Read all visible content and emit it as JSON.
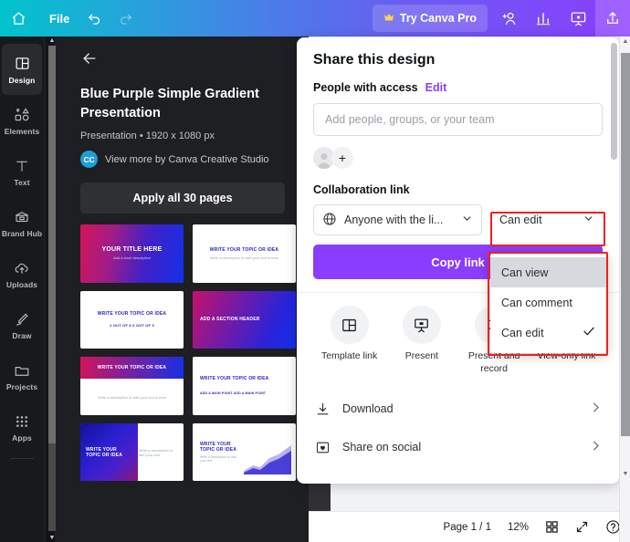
{
  "topbar": {
    "home_icon": "home-icon",
    "file_label": "File",
    "undo_icon": "undo-icon",
    "redo_icon": "redo-icon",
    "pro_label": "Try Canva Pro",
    "crown_icon": "crown-icon",
    "add_person_icon": "add-person-icon",
    "analytics_icon": "bar-chart-icon",
    "present_icon": "present-icon",
    "share_icon": "share-upload-icon",
    "gradient_start": "#00c4cc",
    "gradient_end": "#8b3dff"
  },
  "sidebar": {
    "items": [
      {
        "label": "Design",
        "icon": "layout-icon",
        "active": true
      },
      {
        "label": "Elements",
        "icon": "shapes-icon",
        "active": false
      },
      {
        "label": "Text",
        "icon": "text-t-icon",
        "active": false
      },
      {
        "label": "Brand Hub",
        "icon": "brand-hub-icon",
        "active": false
      },
      {
        "label": "Uploads",
        "icon": "cloud-up-icon",
        "active": false
      },
      {
        "label": "Draw",
        "icon": "pencil-icon",
        "active": false
      },
      {
        "label": "Projects",
        "icon": "folder-icon",
        "active": false
      },
      {
        "label": "Apps",
        "icon": "grid-dots-icon",
        "active": false
      }
    ]
  },
  "template_panel": {
    "back_icon": "back-arrow-icon",
    "title": "Blue Purple Simple Gradient Presentation",
    "meta": "Presentation • 1920 x 1080 px",
    "author_badge": "CC",
    "author_text": "View more by Canva Creative Studio",
    "apply_label": "Apply all 30 pages",
    "thumbnails": [
      {
        "style": "grad1",
        "layout": "center",
        "title": "YOUR TITLE HERE",
        "sub": "Add a short description"
      },
      {
        "style": "white",
        "layout": "center",
        "title": "WRITE YOUR TOPIC OR IDEA",
        "sub": "Write a description or add your text in here"
      },
      {
        "style": "white",
        "layout": "center",
        "title": "WRITE YOUR TOPIC OR IDEA",
        "sub": "2 OUT OF 8         9 OUT OF 9"
      },
      {
        "style": "grad2",
        "layout": "center",
        "title": "ADD A SECTION HEADER",
        "sub": ""
      },
      {
        "style": "grad1",
        "layout": "center",
        "title": "WRITE YOUR TOPIC OR IDEA",
        "sub": "Write a description or add your text in here"
      },
      {
        "style": "white",
        "layout": "left",
        "title": "WRITE YOUR TOPIC OR IDEA",
        "sub": "ADD A MAIN POINT        ADD A MAIN POINT"
      },
      {
        "style": "grad3",
        "layout": "left",
        "title": "WRITE YOUR TOPIC OR IDEA",
        "sub": "Write a description or add your text"
      },
      {
        "style": "white",
        "layout": "left",
        "title": "WRITE YOUR TOPIC OR IDEA",
        "sub": "Write a description or add your text"
      }
    ]
  },
  "share": {
    "title": "Share this design",
    "people_label": "People with access",
    "edit_link": "Edit",
    "input_placeholder": "Add people, groups, or your team",
    "avatar_icon": "user-avatar-icon",
    "add_person_icon": "plus-icon",
    "collab_label": "Collaboration link",
    "globe_icon": "globe-icon",
    "audience_value": "Anyone with the li...",
    "audience_chevron": "chevron-down-icon",
    "permission_value": "Can edit",
    "permission_chevron": "chevron-down-icon",
    "copy_label": "Copy link",
    "copy_color": "#8b3dff",
    "highlight_color": "#ef2020",
    "actions": [
      {
        "label": "Template link",
        "icon": "template-link-icon"
      },
      {
        "label": "Present",
        "icon": "present-screen-icon"
      },
      {
        "label": "Present and record",
        "icon": "record-icon"
      },
      {
        "label": "View-only link",
        "icon": "eye-link-icon"
      }
    ],
    "menu": [
      {
        "label": "Download",
        "icon": "download-icon",
        "chevron": "chevron-right-icon"
      },
      {
        "label": "Share on social",
        "icon": "social-heart-icon",
        "chevron": "chevron-right-icon"
      }
    ]
  },
  "dropdown": {
    "options": [
      {
        "label": "Can view",
        "selected": false,
        "highlighted": true
      },
      {
        "label": "Can comment",
        "selected": false,
        "highlighted": false
      },
      {
        "label": "Can edit",
        "selected": true,
        "highlighted": false
      }
    ],
    "check_icon": "check-icon"
  },
  "statusbar": {
    "page_label": "Page 1 / 1",
    "zoom_label": "12%",
    "grid_icon": "grid-view-icon",
    "expand_icon": "expand-icon",
    "help_icon": "help-question-icon"
  },
  "canvas": {
    "page_number": "1"
  }
}
